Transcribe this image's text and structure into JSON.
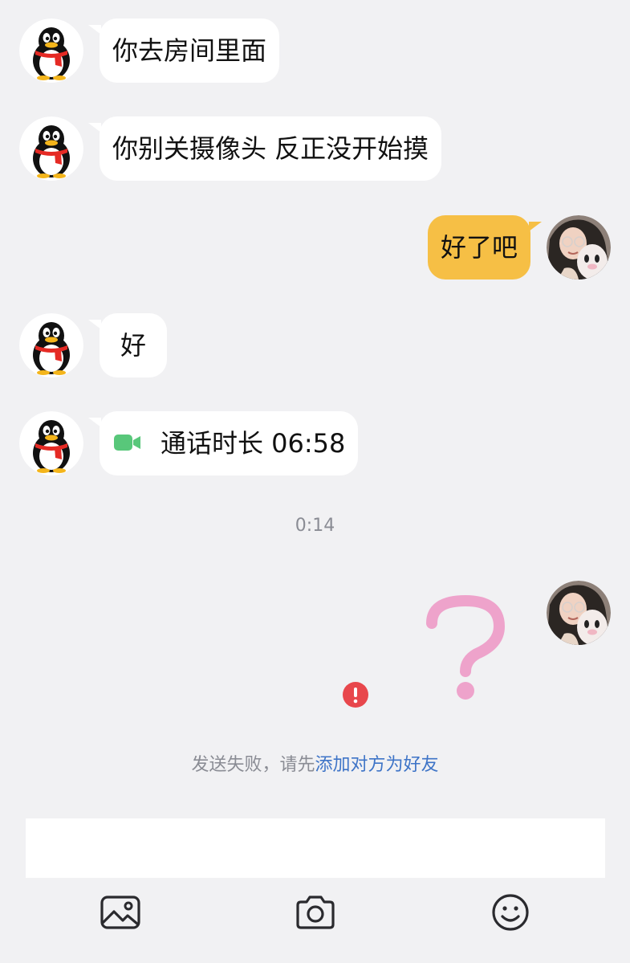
{
  "messages": [
    {
      "side": "received",
      "text": "你去房间里面"
    },
    {
      "side": "received",
      "text": "你别关摄像头 反正没开始摸"
    },
    {
      "side": "sent",
      "text": "好了吧"
    },
    {
      "side": "received",
      "text": "好"
    },
    {
      "side": "received",
      "type": "video-call",
      "text": "通话时长 06:58",
      "icon": "video-camera-icon"
    }
  ],
  "timestamp": "0:14",
  "failed_message": {
    "content": "pink question mark sticker",
    "status_icon": "error-icon",
    "notice_text": "发送失败，请先",
    "notice_link": "添加对方为好友"
  },
  "toolbar": {
    "icons": [
      "image-icon",
      "camera-icon",
      "emoji-icon"
    ]
  },
  "colors": {
    "background": "#f1f1f3",
    "received_bubble": "#ffffff",
    "sent_bubble": "#f6bf45",
    "error": "#e8474c",
    "link": "#3e74c7",
    "call_icon": "#58c77a",
    "sticker": "#eea3cb"
  }
}
